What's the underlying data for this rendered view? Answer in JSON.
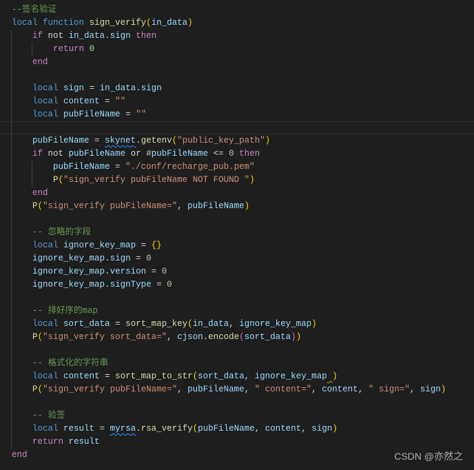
{
  "colors": {
    "background": "#1e1e1e",
    "keyword": "#569cd6",
    "control": "#c586c0",
    "variable": "#9cdcfe",
    "function": "#dcdcaa",
    "string": "#ce9178",
    "number": "#b5cea8",
    "comment": "#6a9955",
    "bracket": "#ffd700"
  },
  "current_line": 10,
  "lines": [
    {
      "indent": 0,
      "tokens": [
        [
          "cm",
          "--签名验证"
        ]
      ]
    },
    {
      "indent": 0,
      "tokens": [
        [
          "k",
          "local"
        ],
        [
          "o",
          " "
        ],
        [
          "k",
          "function"
        ],
        [
          "o",
          " "
        ],
        [
          "f",
          "sign_verify"
        ],
        [
          "b",
          "("
        ],
        [
          "v",
          "in_data"
        ],
        [
          "b",
          ")"
        ]
      ]
    },
    {
      "indent": 1,
      "tokens": [
        [
          "c",
          "if"
        ],
        [
          "o",
          " not "
        ],
        [
          "v",
          "in_data"
        ],
        [
          "o",
          "."
        ],
        [
          "v",
          "sign"
        ],
        [
          "o",
          " "
        ],
        [
          "c",
          "then"
        ]
      ]
    },
    {
      "indent": 2,
      "tokens": [
        [
          "c",
          "return"
        ],
        [
          "o",
          " "
        ],
        [
          "n",
          "0"
        ]
      ]
    },
    {
      "indent": 1,
      "tokens": [
        [
          "c",
          "end"
        ]
      ]
    },
    {
      "indent": 0,
      "tokens": []
    },
    {
      "indent": 1,
      "tokens": [
        [
          "k",
          "local"
        ],
        [
          "o",
          " "
        ],
        [
          "v",
          "sign"
        ],
        [
          "o",
          " = "
        ],
        [
          "v",
          "in_data"
        ],
        [
          "o",
          "."
        ],
        [
          "v",
          "sign"
        ]
      ]
    },
    {
      "indent": 1,
      "tokens": [
        [
          "k",
          "local"
        ],
        [
          "o",
          " "
        ],
        [
          "v",
          "content"
        ],
        [
          "o",
          " = "
        ],
        [
          "s",
          "\"\""
        ]
      ]
    },
    {
      "indent": 1,
      "tokens": [
        [
          "k",
          "local"
        ],
        [
          "o",
          " "
        ],
        [
          "v",
          "pubFileName"
        ],
        [
          "o",
          " = "
        ],
        [
          "s",
          "\"\""
        ]
      ]
    },
    {
      "indent": 0,
      "tokens": []
    },
    {
      "indent": 1,
      "tokens": [
        [
          "v",
          "pubFileName"
        ],
        [
          "o",
          " = "
        ],
        [
          "v sq",
          "skynet"
        ],
        [
          "o",
          "."
        ],
        [
          "f",
          "getenv"
        ],
        [
          "b",
          "("
        ],
        [
          "s",
          "\"public_key_path\""
        ],
        [
          "b",
          ")"
        ]
      ]
    },
    {
      "indent": 1,
      "tokens": [
        [
          "c",
          "if"
        ],
        [
          "o",
          " not "
        ],
        [
          "v",
          "pubFileName"
        ],
        [
          "o",
          " or #"
        ],
        [
          "v",
          "pubFileName"
        ],
        [
          "o",
          " <= "
        ],
        [
          "n",
          "0"
        ],
        [
          "o",
          " "
        ],
        [
          "c",
          "then"
        ]
      ]
    },
    {
      "indent": 2,
      "tokens": [
        [
          "v",
          "pubFileName"
        ],
        [
          "o",
          " = "
        ],
        [
          "s",
          "\"./conf/recharge_pub.pem\""
        ]
      ]
    },
    {
      "indent": 2,
      "tokens": [
        [
          "f",
          "P"
        ],
        [
          "b",
          "("
        ],
        [
          "s",
          "\"sign_verify pubFileName NOT FOUND \""
        ],
        [
          "b",
          ")"
        ]
      ]
    },
    {
      "indent": 1,
      "tokens": [
        [
          "c",
          "end"
        ]
      ]
    },
    {
      "indent": 1,
      "tokens": [
        [
          "f",
          "P"
        ],
        [
          "b",
          "("
        ],
        [
          "s",
          "\"sign_verify pubFileName=\""
        ],
        [
          "o",
          ", "
        ],
        [
          "v",
          "pubFileName"
        ],
        [
          "b",
          ")"
        ]
      ]
    },
    {
      "indent": 0,
      "tokens": []
    },
    {
      "indent": 1,
      "tokens": [
        [
          "cm",
          "-- 忽略的字段"
        ]
      ]
    },
    {
      "indent": 1,
      "tokens": [
        [
          "k",
          "local"
        ],
        [
          "o",
          " "
        ],
        [
          "v",
          "ignore_key_map"
        ],
        [
          "o",
          " = "
        ],
        [
          "b",
          "{}"
        ]
      ]
    },
    {
      "indent": 1,
      "tokens": [
        [
          "v",
          "ignore_key_map"
        ],
        [
          "o",
          "."
        ],
        [
          "v",
          "sign"
        ],
        [
          "o",
          " = "
        ],
        [
          "n",
          "0"
        ]
      ]
    },
    {
      "indent": 1,
      "tokens": [
        [
          "v",
          "ignore_key_map"
        ],
        [
          "o",
          "."
        ],
        [
          "v",
          "version"
        ],
        [
          "o",
          " = "
        ],
        [
          "n",
          "0"
        ]
      ]
    },
    {
      "indent": 1,
      "tokens": [
        [
          "v",
          "ignore_key_map"
        ],
        [
          "o",
          "."
        ],
        [
          "v",
          "signType"
        ],
        [
          "o",
          " = "
        ],
        [
          "n",
          "0"
        ]
      ]
    },
    {
      "indent": 0,
      "tokens": []
    },
    {
      "indent": 1,
      "tokens": [
        [
          "cm",
          "-- 排好序的map"
        ]
      ]
    },
    {
      "indent": 1,
      "tokens": [
        [
          "k",
          "local"
        ],
        [
          "o",
          " "
        ],
        [
          "v",
          "sort_data"
        ],
        [
          "o",
          " = "
        ],
        [
          "f",
          "sort_map_key"
        ],
        [
          "b",
          "("
        ],
        [
          "v",
          "in_data"
        ],
        [
          "o",
          ", "
        ],
        [
          "v",
          "ignore_key_map"
        ],
        [
          "b",
          ")"
        ]
      ]
    },
    {
      "indent": 1,
      "tokens": [
        [
          "f",
          "P"
        ],
        [
          "b",
          "("
        ],
        [
          "s",
          "\"sign_verify sort_data=\""
        ],
        [
          "o",
          ", "
        ],
        [
          "v",
          "cjson"
        ],
        [
          "o",
          "."
        ],
        [
          "f",
          "encode"
        ],
        [
          "b2",
          "("
        ],
        [
          "v",
          "sort_data"
        ],
        [
          "b2",
          ")"
        ],
        [
          "b",
          ")"
        ]
      ]
    },
    {
      "indent": 0,
      "tokens": []
    },
    {
      "indent": 1,
      "tokens": [
        [
          "cm",
          "-- 格式化的字符串"
        ]
      ]
    },
    {
      "indent": 1,
      "tokens": [
        [
          "k",
          "local"
        ],
        [
          "o",
          " "
        ],
        [
          "v",
          "content"
        ],
        [
          "o",
          " = "
        ],
        [
          "f",
          "sort_map_to_str"
        ],
        [
          "b",
          "("
        ],
        [
          "v",
          "sort_data"
        ],
        [
          "o",
          ", "
        ],
        [
          "v",
          "ignore_key_map"
        ],
        [
          "o sqy",
          " "
        ],
        [
          "b",
          ")"
        ]
      ]
    },
    {
      "indent": 1,
      "tokens": [
        [
          "f",
          "P"
        ],
        [
          "b",
          "("
        ],
        [
          "s",
          "\"sign_verify pubFileName=\""
        ],
        [
          "o",
          ", "
        ],
        [
          "v",
          "pubFileName"
        ],
        [
          "o",
          ", "
        ],
        [
          "s",
          "\" content=\""
        ],
        [
          "o",
          ", "
        ],
        [
          "v",
          "content"
        ],
        [
          "o",
          ", "
        ],
        [
          "s",
          "\" sign=\""
        ],
        [
          "o",
          ", "
        ],
        [
          "v",
          "sign"
        ],
        [
          "b",
          ")"
        ]
      ]
    },
    {
      "indent": 0,
      "tokens": []
    },
    {
      "indent": 1,
      "tokens": [
        [
          "cm",
          "-- 验签"
        ]
      ]
    },
    {
      "indent": 1,
      "tokens": [
        [
          "k",
          "local"
        ],
        [
          "o",
          " "
        ],
        [
          "v",
          "result"
        ],
        [
          "o",
          " = "
        ],
        [
          "v sq",
          "myrsa"
        ],
        [
          "o",
          "."
        ],
        [
          "f",
          "rsa_verify"
        ],
        [
          "b",
          "("
        ],
        [
          "v",
          "pubFileName"
        ],
        [
          "o",
          ", "
        ],
        [
          "v",
          "content"
        ],
        [
          "o",
          ", "
        ],
        [
          "v",
          "sign"
        ],
        [
          "b",
          ")"
        ]
      ]
    },
    {
      "indent": 1,
      "tokens": [
        [
          "c",
          "return"
        ],
        [
          "o",
          " "
        ],
        [
          "v",
          "result"
        ]
      ]
    },
    {
      "indent": 0,
      "tokens": [
        [
          "c",
          "end"
        ]
      ]
    }
  ],
  "watermark": "CSDN @亦然之"
}
